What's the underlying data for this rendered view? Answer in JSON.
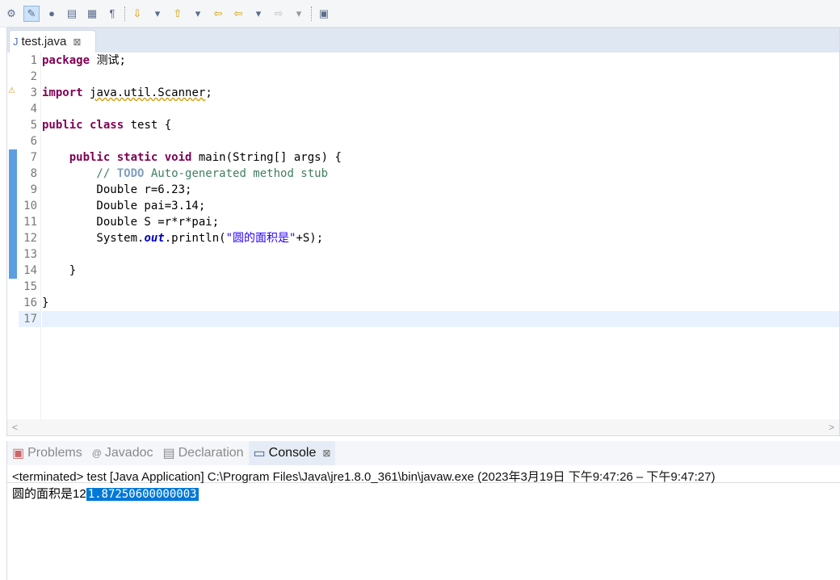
{
  "toolbar": {
    "icons": [
      "debug-icon",
      "mark-occurrences-icon",
      "toggle-breadcrumb-icon",
      "block-selection-icon",
      "word-wrap-icon",
      "whitespace-icon",
      "next-annotation-icon",
      "prev-annotation-icon",
      "last-edit-icon",
      "back-icon",
      "forward-icon",
      "pin-editor-icon"
    ],
    "pilcrow": "¶"
  },
  "editor": {
    "tab_label": "test.java",
    "close": "⊠",
    "line_numbers": [
      "1",
      "2",
      "3",
      "4",
      "5",
      "6",
      "7",
      "8",
      "9",
      "10",
      "11",
      "12",
      "13",
      "14",
      "15",
      "16",
      "17"
    ]
  },
  "code": {
    "l1a": "package",
    " l1b": " 测试;",
    "l3a": "import",
    "l3b": " ",
    "l3c": "java.util.Scanner",
    ";": ";",
    "l5a": "public class",
    "l5b": " test {",
    "l7a": "    public static void",
    "l7b": " main(String[] args) {",
    "l8a": "        // ",
    "l8b": "TODO",
    "l8c": " Auto-generated method stub",
    "l9": "        Double r=6.23;",
    "l10": "        Double pai=3.14;",
    "l11": "        Double S =r*r*pai;",
    "l12a": "        System.",
    "l12b": "out",
    "l12c": ".println(",
    "l12d": "\"圆的面积是\"",
    "l12e": "+S);",
    "l14": "    }",
    "l16": "}"
  },
  "views": {
    "tabs": [
      "Problems",
      "Javadoc",
      "Declaration",
      "Console"
    ],
    "close": "⊠"
  },
  "console": {
    "status": "<terminated> test [Java Application] C:\\Program Files\\Java\\jre1.8.0_361\\bin\\javaw.exe  (2023年3月19日 下午9:47:26 – 下午9:47:27)",
    "output_prefix": "圆的面积是12",
    "output_selected": "1.87250600000003 "
  }
}
